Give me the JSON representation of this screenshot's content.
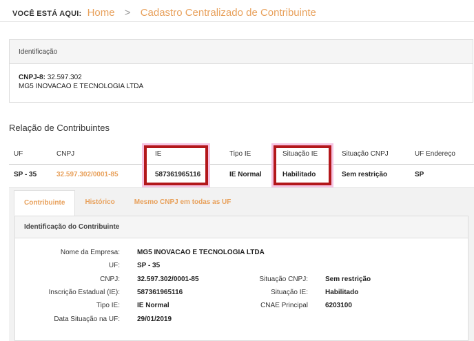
{
  "breadcrumb": {
    "lead": "VOCÊ ESTÁ AQUI:",
    "home": "Home",
    "separator": ">",
    "current": "Cadastro Centralizado de Contribuinte"
  },
  "identificacao": {
    "header": "Identificação",
    "cnpj_label": "CNPJ-8:",
    "cnpj_value": "32.597.302",
    "company": "MG5 INOVACAO E TECNOLOGIA LTDA"
  },
  "relacao": {
    "title": "Relação de Contribuintes",
    "columns": [
      "UF",
      "CNPJ",
      "IE",
      "Tipo IE",
      "Situação IE",
      "Situação CNPJ",
      "UF Endereço"
    ],
    "row": {
      "uf": "SP - 35",
      "cnpj": "32.597.302/0001-85",
      "ie": "587361965116",
      "tipo_ie": "IE Normal",
      "situacao_ie": "Habilitado",
      "situacao_cnpj": "Sem restrição",
      "uf_endereco": "SP"
    }
  },
  "tabs": [
    "Contribuinte",
    "Histórico",
    "Mesmo CNPJ em todas as UF"
  ],
  "contribuinte": {
    "header": "Identificação do Contribuinte",
    "left": [
      {
        "label": "Nome da Empresa:",
        "value": "MG5 INOVACAO E TECNOLOGIA LTDA"
      },
      {
        "label": "UF:",
        "value": "SP - 35"
      },
      {
        "label": "CNPJ:",
        "value": "32.597.302/0001-85"
      },
      {
        "label": "Inscrição Estadual (IE):",
        "value": "587361965116"
      },
      {
        "label": "Tipo IE:",
        "value": "IE Normal"
      },
      {
        "label": "Data Situação na UF:",
        "value": "29/01/2019"
      }
    ],
    "right": [
      {
        "label": "Situação CNPJ:",
        "value": "Sem restrição"
      },
      {
        "label": "Situação IE:",
        "value": "Habilitado"
      },
      {
        "label": "CNAE Principal",
        "value": "6203100"
      }
    ]
  },
  "colors": {
    "accent": "#e8a15c",
    "highlight_border": "#b3171b",
    "highlight_glow": "#f6c4e3"
  }
}
